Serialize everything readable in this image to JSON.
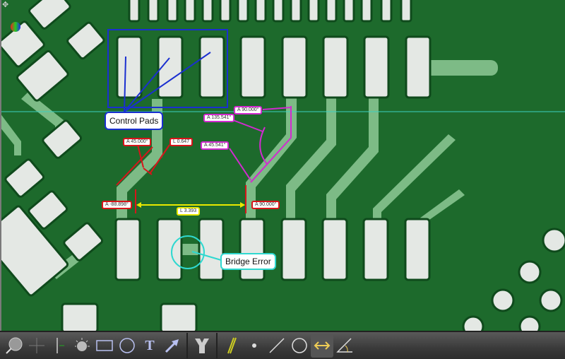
{
  "annotations": {
    "control_pads": "Control Pads",
    "bridge_error": "Bridge Error",
    "angle_top": "A   90.000°",
    "angle_135": "A   135.541°",
    "angle_45": "A   45.000°",
    "length_0647": "L   0.647",
    "angle_45541": "A   45.541°",
    "angle_left": "A   -88.898°",
    "angle_right": "A   90.000°",
    "length_3393": "L   3.393"
  },
  "colors": {
    "board": "#1d6a2c",
    "trace": "#7dbb86",
    "pad": "#e4e8e4",
    "control_box": "#1a2fd0",
    "angle": "#d22ad0",
    "measure": "#d8141a",
    "length": "#e8e800",
    "bridge": "#2fd8d0"
  },
  "toolbar": {
    "tools": [
      "magnifier-icon",
      "crosshair-icon",
      "calibrate-icon",
      "brightness-icon",
      "rectangle-icon",
      "circle-select-icon",
      "text-icon",
      "arrow-icon",
      "y-split-icon",
      "parallel-lines-icon",
      "point-icon",
      "line-icon",
      "circle-icon",
      "distance-icon",
      "angle-icon"
    ],
    "active": "distance-icon"
  }
}
